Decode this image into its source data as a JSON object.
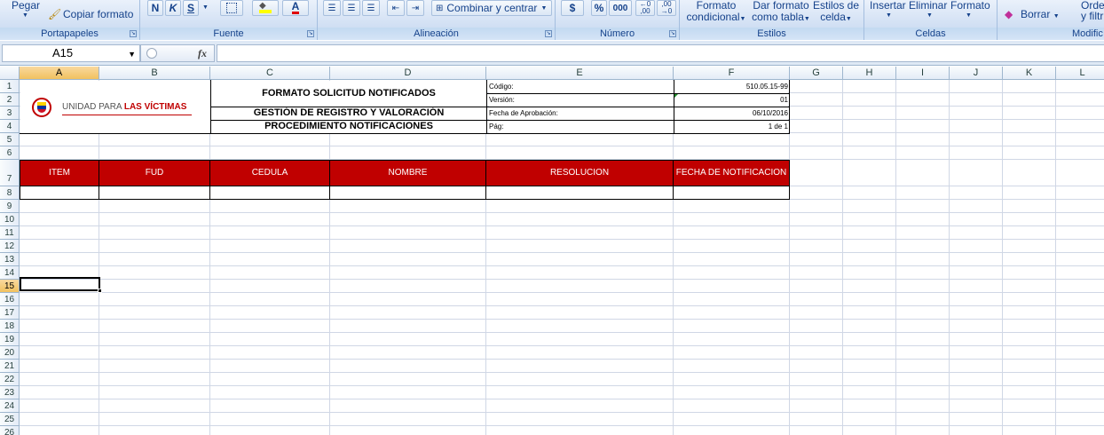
{
  "ribbon": {
    "portapapeles": {
      "label": "Portapapeles",
      "pegar": "Pegar",
      "copiar_formato": "Copiar formato"
    },
    "fuente": {
      "label": "Fuente",
      "bold": "N",
      "italic": "K",
      "underline": "S",
      "font_color_letter": "A"
    },
    "alineacion": {
      "label": "Alineación",
      "combinar": "Combinar y centrar"
    },
    "numero": {
      "label": "Número",
      "currency": "$",
      "percent": "%",
      "thousands": "000",
      "inc_dec": "←0 ,00",
      "dec_dec": ",00 →0"
    },
    "estilos": {
      "label": "Estilos",
      "formato_condicional_1": "Formato",
      "formato_condicional_2": "condicional",
      "dar_formato_1": "Dar formato",
      "dar_formato_2": "como tabla",
      "estilos_celda_1": "Estilos de",
      "estilos_celda_2": "celda"
    },
    "celdas": {
      "label": "Celdas",
      "insertar": "Insertar",
      "eliminar": "Eliminar",
      "formato": "Formato"
    },
    "modificar": {
      "label": "Modific",
      "borrar": "Borrar",
      "ordenar_1": "Orde",
      "ordenar_2": "y filtr"
    }
  },
  "formula_bar": {
    "name_box": "A15",
    "fx": "fx",
    "formula": ""
  },
  "columns": [
    "A",
    "B",
    "C",
    "D",
    "E",
    "F",
    "G",
    "H",
    "I",
    "J",
    "K",
    "L"
  ],
  "rows": [
    "1",
    "2",
    "3",
    "4",
    "5",
    "6",
    "7",
    "8",
    "9",
    "10",
    "11",
    "12",
    "13",
    "14",
    "15",
    "16",
    "17",
    "18",
    "19",
    "20",
    "21",
    "22",
    "23",
    "24",
    "25",
    "26"
  ],
  "selected_cell": {
    "column": "A",
    "row": "15"
  },
  "sheet": {
    "logo_text_1": "UNIDAD PARA ",
    "logo_text_2": "LAS VÍCTIMAS",
    "title_1": "FORMATO SOLICITUD NOTIFICADOS",
    "title_2": "GESTIÓN DE REGISTRO Y VALORACIÓN",
    "title_3": "PROCEDIMIENTO NOTIFICACIONES",
    "codigo_label": "Código:",
    "codigo_value": "510.05.15-99",
    "version_label": "Versión:",
    "version_value": "01",
    "fecha_label": "Fecha de Aprobación:",
    "fecha_value": "06/10/2016",
    "pag_label": "Pág:",
    "pag_value": "1 de 1",
    "headers": [
      "ITEM",
      "FUD",
      "CEDULA",
      "NOMBRE",
      "RESOLUCION",
      "FECHA DE NOTIFICACION"
    ]
  },
  "colors": {
    "header_red": "#c00000",
    "ribbon_text": "#15428b",
    "logo_red": "#c00000"
  }
}
